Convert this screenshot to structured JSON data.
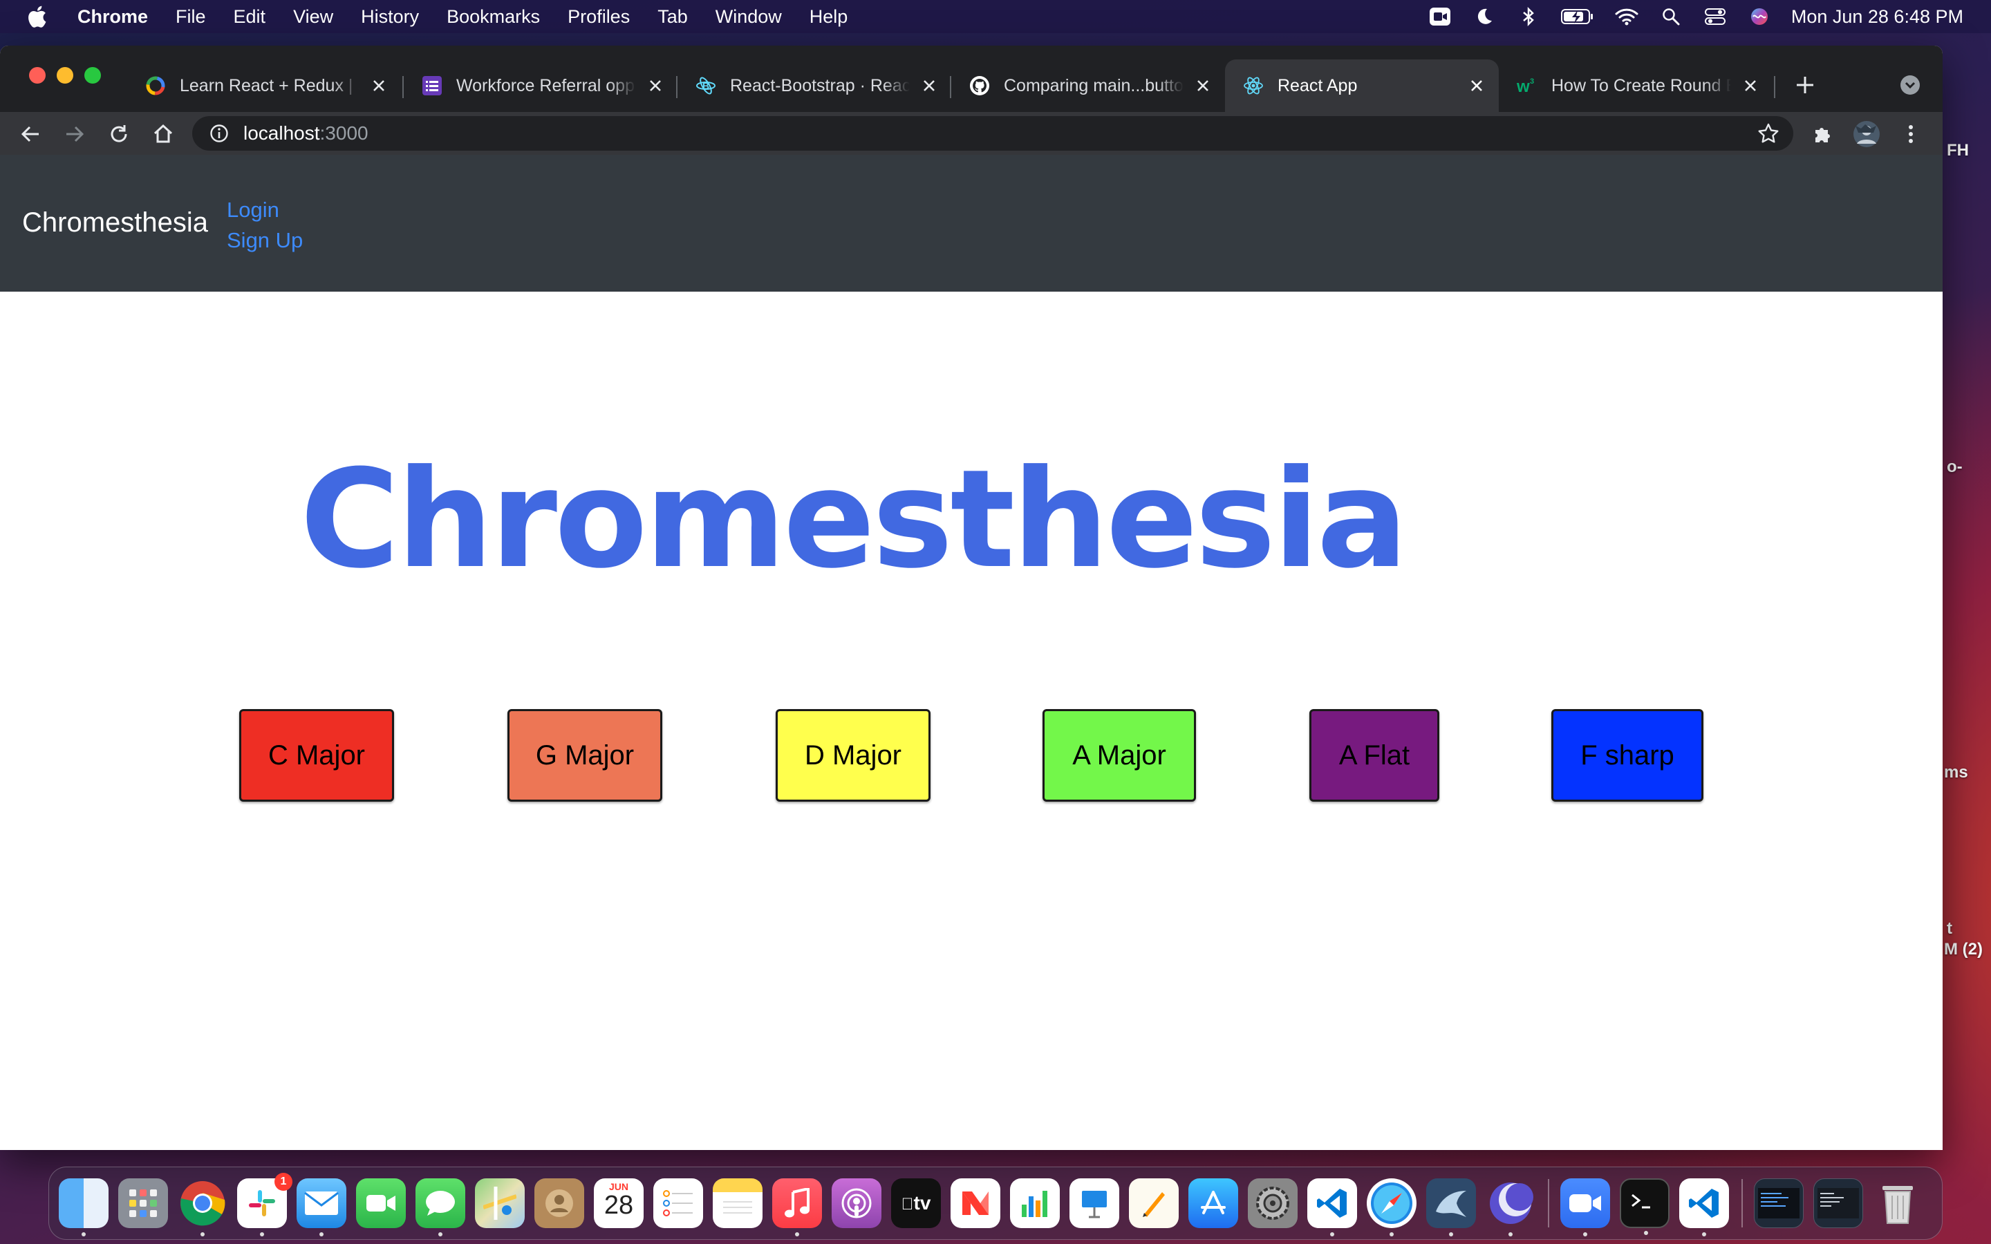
{
  "menubar": {
    "app_name": "Chrome",
    "items": [
      "File",
      "Edit",
      "View",
      "History",
      "Bookmarks",
      "Profiles",
      "Tab",
      "Window",
      "Help"
    ],
    "clock": "Mon Jun 28  6:48 PM"
  },
  "desktop_labels": [
    "FH",
    "o-",
    "ms",
    "t",
    "M (2)"
  ],
  "browser": {
    "tabs": [
      {
        "title": "Learn React + Redux | S",
        "icon": "google-icon",
        "active": false
      },
      {
        "title": "Workforce Referral opp",
        "icon": "list-icon",
        "active": false
      },
      {
        "title": "React-Bootstrap · React",
        "icon": "bootstrap-icon",
        "active": false
      },
      {
        "title": "Comparing main...butto",
        "icon": "github-icon",
        "active": false
      },
      {
        "title": "React App",
        "icon": "react-icon",
        "active": true
      },
      {
        "title": "How To Create Round B",
        "icon": "w3schools-icon",
        "active": false
      }
    ],
    "address": {
      "host": "localhost",
      "port": ":3000"
    }
  },
  "page": {
    "brand": "Chromesthesia",
    "nav_links": [
      "Login",
      "Sign Up"
    ],
    "title": "Chromesthesia",
    "key_buttons": [
      {
        "label": "C Major",
        "color": "#ee2e24"
      },
      {
        "label": "G Major",
        "color": "#ed7655"
      },
      {
        "label": "D Major",
        "color": "#ffff4d"
      },
      {
        "label": "A Major",
        "color": "#73f74a"
      },
      {
        "label": "A Flat",
        "color": "#771a7f"
      },
      {
        "label": "F sharp",
        "color": "#0433ff"
      }
    ]
  },
  "dock": {
    "calendar_month": "JUN",
    "calendar_day": "28",
    "tv_label": "tv",
    "slack_badge": "1"
  }
}
